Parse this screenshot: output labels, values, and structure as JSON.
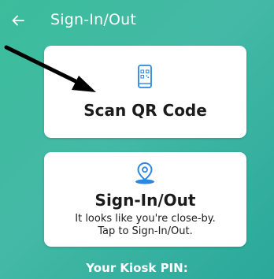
{
  "header": {
    "title": "Sign-In/Out",
    "back_icon": "arrow-left-icon"
  },
  "qr_card": {
    "icon": "qr-phone-icon",
    "title": "Scan QR Code"
  },
  "signin_card": {
    "icon": "location-pin-icon",
    "title": "Sign-In/Out",
    "subtitle_line1": "It looks like you're close-by.",
    "subtitle_line2": "Tap to Sign-In/Out."
  },
  "footer": {
    "kiosk_label": "Your Kiosk PIN:"
  },
  "colors": {
    "background": "#3bbd9b",
    "accent": "#2e86de",
    "card": "#ffffff",
    "text": "#1b1b1b"
  }
}
